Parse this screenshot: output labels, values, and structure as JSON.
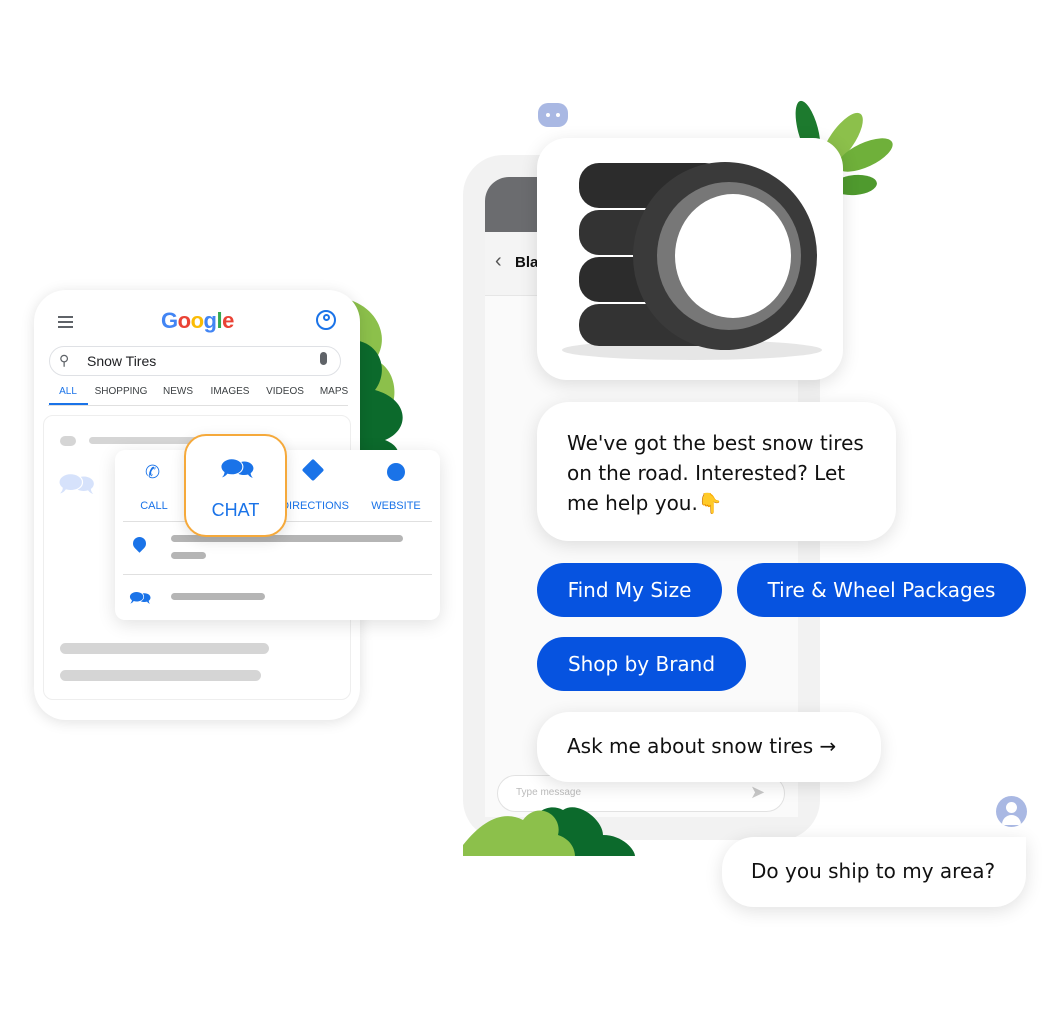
{
  "google": {
    "logo": "Google",
    "search_value": "Snow Tires",
    "tabs": [
      "ALL",
      "SHOPPING",
      "NEWS",
      "IMAGES",
      "VIDEOS",
      "MAPS"
    ],
    "active_tab": "ALL",
    "actions": {
      "call": "CALL",
      "chat": "CHAT",
      "directions": "DIRECTIONS",
      "website": "WEBSITE"
    },
    "colors": {
      "blue": "#1a73e8",
      "highlight": "#f5a93b"
    }
  },
  "chat": {
    "header_title": "Bla",
    "bot_message": "We've got the best snow tires on the road. Interested? Let me help you.👇",
    "quick_replies": [
      "Find My Size",
      "Tire & Wheel Packages",
      "Shop by Brand"
    ],
    "suggestion": "Ask me about snow tires →",
    "input_placeholder": "Type message",
    "user_message": "Do you ship to my area?",
    "colors": {
      "button": "#0653e0",
      "avatar": "#a9b8e3"
    }
  }
}
